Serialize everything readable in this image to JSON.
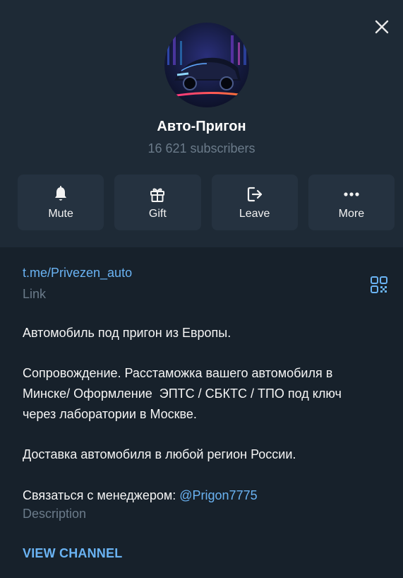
{
  "channel": {
    "title": "Авто-Пригон",
    "subscribers": "16 621 subscribers"
  },
  "actions": [
    {
      "label": "Mute",
      "icon": "bell-icon"
    },
    {
      "label": "Gift",
      "icon": "gift-icon"
    },
    {
      "label": "Leave",
      "icon": "leave-icon"
    },
    {
      "label": "More",
      "icon": "more-dots-icon"
    }
  ],
  "link": {
    "url": "t.me/Privezen_auto",
    "caption": "Link"
  },
  "description": {
    "line1": "Автомобиль под пригон из Европы.",
    "line2a": "Сопровождение. Расстаможка вашего автомобиля в",
    "line2b": "Минске/ Оформление  ЭПТС / СБКТС / ТПО под ключ",
    "line2c": "через лаборатории в Москве.",
    "line3": "Доставка автомобиля в любой регион России.",
    "contact_prefix": "Связаться с менеджером: ",
    "contact_mention": "@Prigon7775",
    "caption": "Description"
  },
  "view_channel": "VIEW CHANNEL",
  "colors": {
    "background": "#17212b",
    "header": "#1e2a36",
    "button": "#253240",
    "accent": "#6ab3f3",
    "muted": "#6b7b8a"
  }
}
